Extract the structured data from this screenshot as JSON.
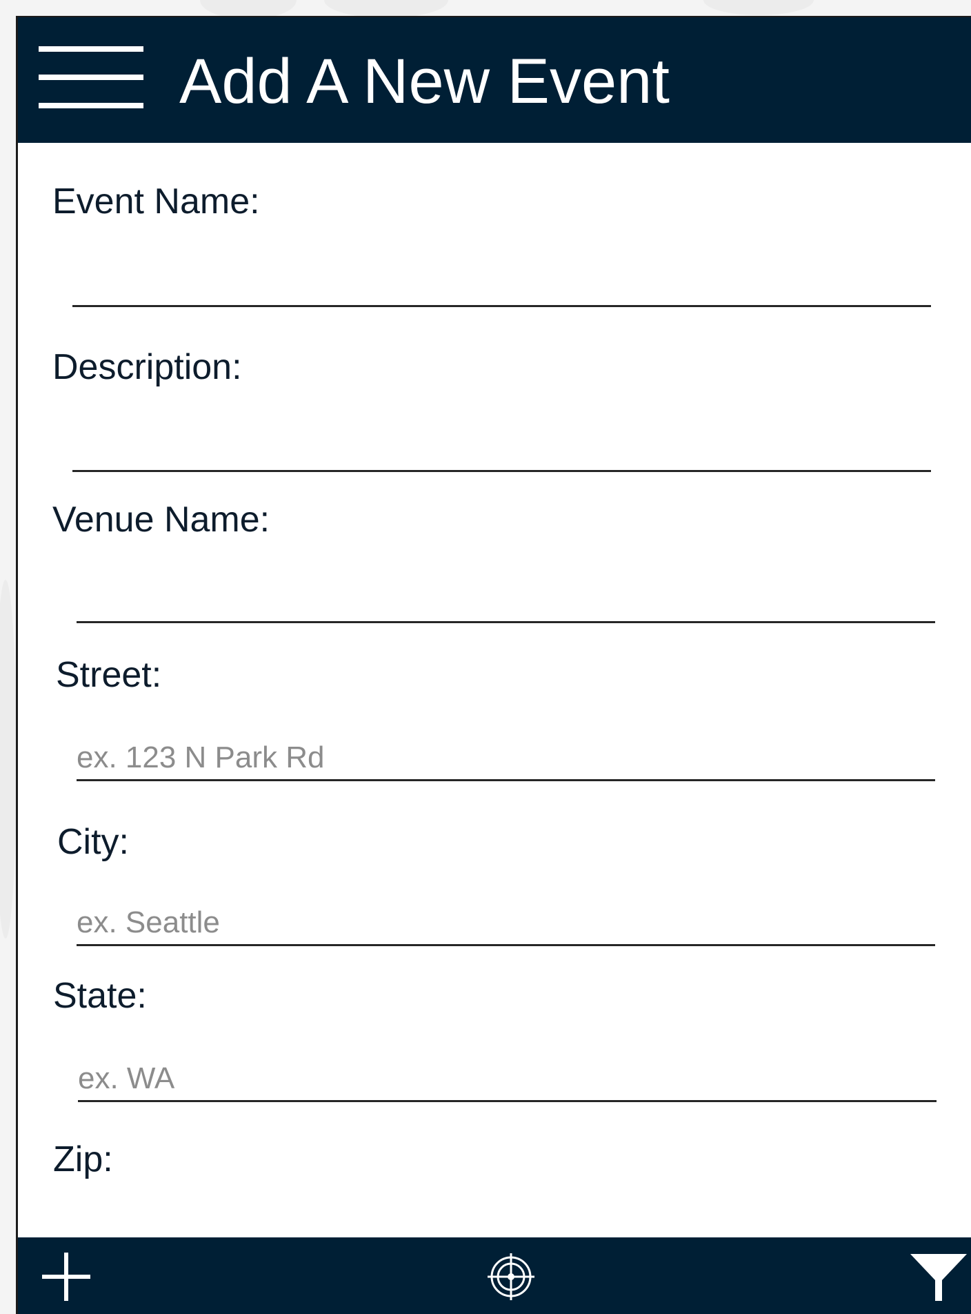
{
  "header": {
    "title": "Add A New Event"
  },
  "form": {
    "fields": [
      {
        "label": "Event Name:",
        "placeholder": "",
        "value": ""
      },
      {
        "label": "Description:",
        "placeholder": "",
        "value": ""
      },
      {
        "label": "Venue Name:",
        "placeholder": "",
        "value": ""
      },
      {
        "label": "Street:",
        "placeholder": "ex. 123 N Park Rd",
        "value": ""
      },
      {
        "label": "City:",
        "placeholder": "ex. Seattle",
        "value": ""
      },
      {
        "label": "State:",
        "placeholder": "ex. WA",
        "value": ""
      },
      {
        "label": "Zip:",
        "placeholder": "",
        "value": ""
      }
    ]
  },
  "footer": {
    "icons": [
      "plus-icon",
      "crosshair-icon",
      "filter-icon"
    ]
  },
  "colors": {
    "bar_background": "#001f35",
    "bar_foreground": "#ffffff",
    "label_text": "#0d1c2c",
    "placeholder_text": "#8c8c8c",
    "page_background": "#ffffff"
  }
}
